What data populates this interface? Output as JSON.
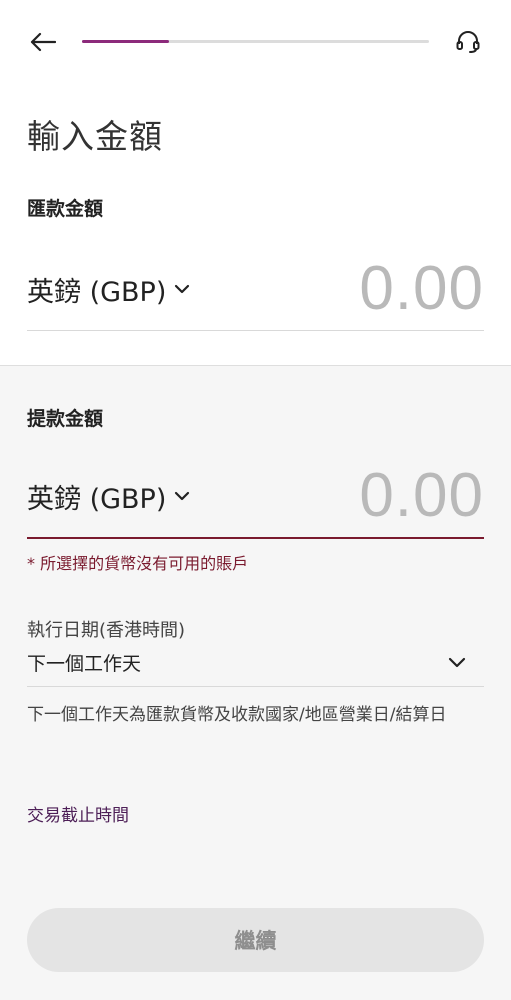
{
  "header": {
    "progress_fraction": 0.25,
    "progress_color": "#8c2a7b",
    "back_icon": "arrow-left-icon",
    "support_icon": "headset-icon"
  },
  "page_title": "輸入金額",
  "send": {
    "label": "匯款金額",
    "currency": "英鎊 (GBP)",
    "amount": "0.00"
  },
  "receive": {
    "label": "提款金額",
    "currency": "英鎊 (GBP)",
    "amount": "0.00",
    "error": "* 所選擇的貨幣沒有可用的賬戶",
    "error_color": "#7a1a2e"
  },
  "execution_date": {
    "label": "執行日期(香港時間)",
    "value": "下一個工作天",
    "note": "下一個工作天為匯款貨幣及收款國家/地區營業日/結算日"
  },
  "cutoff_link": "交易截止時間",
  "continue_label": "繼續"
}
